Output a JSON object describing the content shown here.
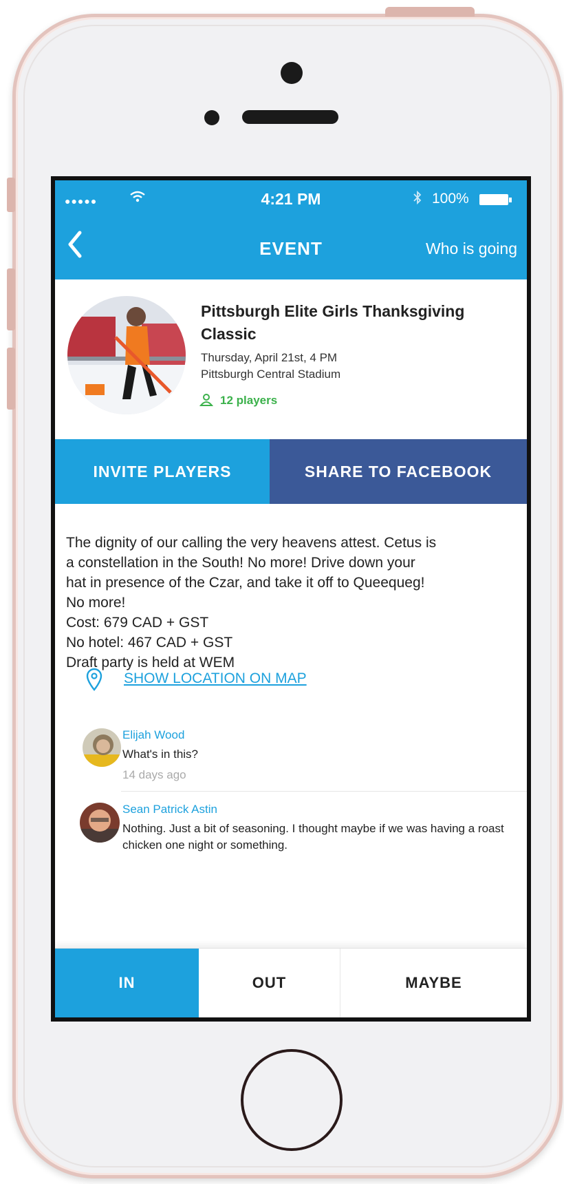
{
  "status_bar": {
    "signal": "●●●●●",
    "time": "4:21 PM",
    "battery": "100%"
  },
  "nav": {
    "title": "EVENT",
    "who_is_going": "Who is going"
  },
  "event": {
    "title": "Pittsburgh Elite Girls Thanksgiving Classic",
    "date": "Thursday, April 21st, 4 PM",
    "venue": "Pittsburgh Central Stadium",
    "players": "12 players"
  },
  "actions": {
    "invite": "INVITE PLAYERS",
    "share": "SHARE TO FACEBOOK"
  },
  "description": {
    "lines": [
      "The dignity of our calling the very heavens attest. Cetus is",
      "a constellation in the South! No more! Drive down your",
      "hat in presence of the Czar, and take it off to Queequeg!",
      "No more!",
      "Cost: 679 CAD + GST",
      "No hotel: 467 CAD + GST",
      "Draft party is held at WEM"
    ]
  },
  "map": {
    "link": "SHOW LOCATION ON MAP"
  },
  "comments": [
    {
      "name": "Elijah Wood",
      "text": "What's in this?",
      "time": "14 days ago"
    },
    {
      "name": "Sean Patrick Astin",
      "text": "Nothing. Just a bit of seasoning. I thought maybe if we was having a roast chicken one night or something.",
      "time": ""
    }
  ],
  "rsvp": {
    "in": "IN",
    "out": "OUT",
    "maybe": "MAYBE",
    "selected": "IN"
  },
  "colors": {
    "primary": "#1da1dd",
    "facebook": "#3b5998",
    "players_green": "#3bb14b",
    "phone_rim": "#e3c3bd"
  }
}
